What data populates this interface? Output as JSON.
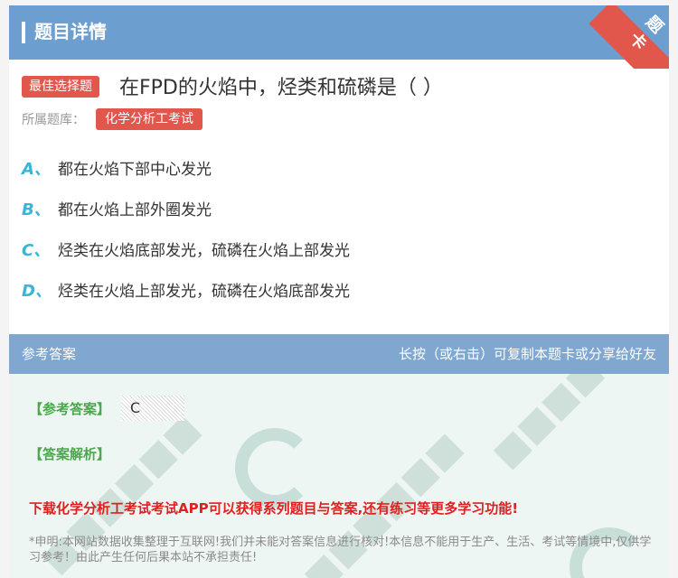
{
  "header": {
    "title": "题目详情"
  },
  "corner_badge": "题卡",
  "question": {
    "type_badge": "最佳选择题",
    "text": "在FPD的火焰中，烃类和硫磷是（ ）",
    "library_label": "所属题库：",
    "library_name": "化学分析工考试"
  },
  "options": [
    {
      "letter": "A、",
      "text": "都在火焰下部中心发光"
    },
    {
      "letter": "B、",
      "text": "都在火焰上部外圈发光"
    },
    {
      "letter": "C、",
      "text": "烃类在火焰底部发光，硫磷在火焰上部发光"
    },
    {
      "letter": "D、",
      "text": "烃类在火焰上部发光，硫磷在火焰底部发光"
    }
  ],
  "answer_section": {
    "title": "参考答案",
    "share_hint": "长按（或右击）可复制本题卡或分享给好友",
    "answer_label": "【参考答案】",
    "answer_value": "C",
    "analysis_label": "【答案解析】",
    "promo": "下载化学分析工考试考试APP可以获得系列题目与答案,还有练习等更多学习功能!",
    "disclaimer": "*申明:本网站数据收集整理于互联网!我们并未能对答案信息进行核对!本信息不能用于生产、生活、考试等情境中,仅供学习参考！由此产生任何后果本站不承担责任!"
  },
  "colors": {
    "header": "#6c9ecf",
    "badge": "#e2574c",
    "option_letter": "#39b5d6",
    "answer_green": "#4aa84a",
    "promo_red": "#e02020"
  }
}
